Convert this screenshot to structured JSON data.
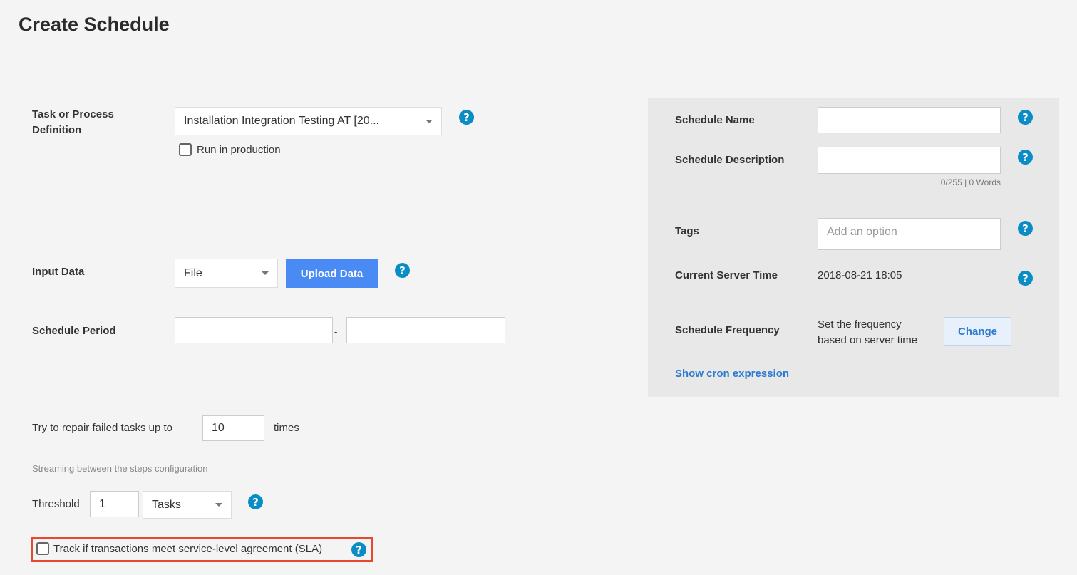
{
  "page": {
    "title": "Create Schedule"
  },
  "left": {
    "task_definition": {
      "label": "Task or Process Definition",
      "selected": "Installation Integration Testing AT [20...",
      "run_in_production_label": "Run in production"
    },
    "input_data": {
      "label": "Input Data",
      "selected": "File",
      "upload_label": "Upload Data"
    },
    "schedule_period": {
      "label": "Schedule Period",
      "separator": "-",
      "start_value": "",
      "end_value": ""
    },
    "repair": {
      "prefix": "Try to repair failed tasks up to",
      "value": "10",
      "suffix": "times"
    },
    "streaming": {
      "heading": "Streaming between the steps configuration"
    },
    "threshold": {
      "label": "Threshold",
      "value": "1",
      "unit_selected": "Tasks"
    },
    "sla": {
      "label": "Track if transactions meet service-level agreement (SLA)"
    }
  },
  "right": {
    "schedule_name": {
      "label": "Schedule Name",
      "value": ""
    },
    "schedule_description": {
      "label": "Schedule Description",
      "value": "",
      "counter": "0/255 | 0 Words"
    },
    "tags": {
      "label": "Tags",
      "placeholder": "Add an option"
    },
    "server_time": {
      "label": "Current Server Time",
      "value": "2018-08-21 18:05"
    },
    "frequency": {
      "label": "Schedule Frequency",
      "hint_line1": "Set the frequency",
      "hint_line2": "based on server time",
      "change_label": "Change"
    },
    "cron_link": "Show cron expression"
  },
  "icons": {
    "help": "?",
    "help_icon_name": "question-circle-icon"
  },
  "colors": {
    "help_icon": "#0a8cc4",
    "primary_button": "#4a8af4",
    "link": "#2d7bd0",
    "sla_highlight": "#e8492d"
  }
}
